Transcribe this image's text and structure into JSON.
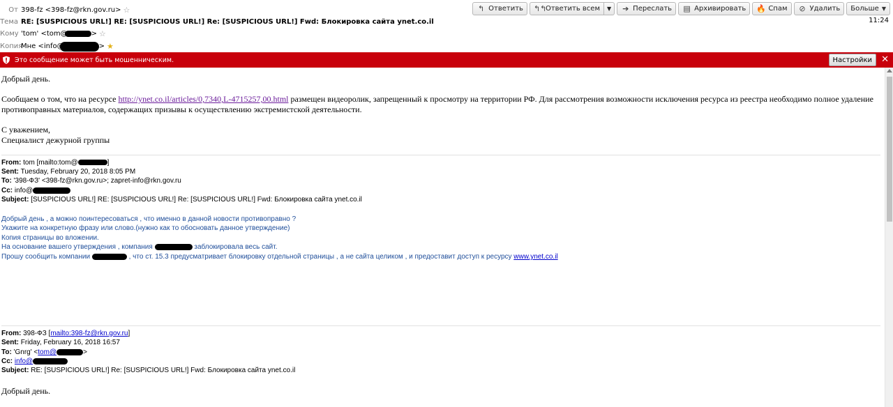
{
  "header": {
    "from_label": "От",
    "from_value": "398-fz <398-fz@rkn.gov.ru>",
    "subject_label": "Тема",
    "subject_value": "RE: [SUSPICIOUS URL!] RE: [SUSPICIOUS URL!] Re: [SUSPICIOUS URL!] Fwd: Блокировка сайта ynet.co.il",
    "to_label": "Кому",
    "to_value": "'tom' <tom@",
    "cc_label": "Копия",
    "cc_value": "Мне <info@",
    "cc_suffix": ">",
    "to_suffix": ">",
    "time": "11:24"
  },
  "toolbar": {
    "reply": "Ответить",
    "reply_all": "Ответить всем",
    "forward": "Переслать",
    "archive": "Архивировать",
    "spam": "Спам",
    "delete": "Удалить",
    "more": "Больше"
  },
  "scam_bar": {
    "text": "Это сообщение может быть мошенническим.",
    "settings": "Настройки"
  },
  "message": {
    "greeting": "Добрый день.",
    "body_before_link": "Сообщаем о том, что на ресурсе ",
    "link": "http://ynet.co.il/articles/0,7340,L-4715257,00.html",
    "body_after_link": " размещен видеоролик, запрещенный к просмотру на территории РФ. Для рассмотрения возможности исключения ресурса из реестра необходимо полное удаление",
    "body_line2": "противоправных материалов, содержащих призывы к осуществлению экстремистской деятельности.",
    "regards": "С уважением,",
    "signature": "Специалист дежурной группы"
  },
  "quote1": {
    "from_label": "From:",
    "from_value": "tom [mailto:tom@",
    "from_end": "]",
    "sent_label": "Sent:",
    "sent_value": "Tuesday, February 20, 2018 8:05 PM",
    "to_label": "To:",
    "to_value": "'398-ФЗ' <398-fz@rkn.gov.ru>; zapret-info@rkn.gov.ru",
    "cc_label": "Cc:",
    "cc_value": "info@",
    "subject_label": "Subject:",
    "subject_value": "[SUSPICIOUS URL!] RE: [SUSPICIOUS URL!] Re: [SUSPICIOUS URL!] Fwd: Блокировка сайта ynet.co.il",
    "line1": "Добрый день , а можно поинтересоваться , что именно в данной новости противоправно ?",
    "line2": "Укажите на конкретную фразу или слово.(нужно как то обосновать данное утверждение)",
    "line3": "Копия страницы во вложении.",
    "line4_a": "На основание вашего утверждения , компания ",
    "line4_b": " заблокировала весь сайт.",
    "line5_a": "Прошу сообщить компании ",
    "line5_b": " , что ст. 15.3 предусматривает блокировку отдельной страницы , а не сайта целиком , и предоставит доступ к ресурсу ",
    "line5_link": "www.ynet.co.il"
  },
  "quote2": {
    "from_label": "From:",
    "from_value": "398-ФЗ [",
    "from_link": "mailto:398-fz@rkn.gov.ru",
    "from_end": "]",
    "sent_label": "Sent:",
    "sent_value": "Friday, February 16, 2018 16:57",
    "to_label": "To:",
    "to_value": "'Gnrg' <",
    "to_link": "tom@",
    "to_end": ">",
    "cc_label": "Cc:",
    "cc_link": "info@",
    "subject_label": "Subject:",
    "subject_value": "RE: [SUSPICIOUS URL!] Re: [SUSPICIOUS URL!] Fwd: Блокировка сайта ynet.co.il",
    "greeting": "Добрый день."
  },
  "colors": {
    "scam_bar": "#c8000b",
    "quote_text": "#1f4e9a",
    "link": "#6a1b9a"
  }
}
